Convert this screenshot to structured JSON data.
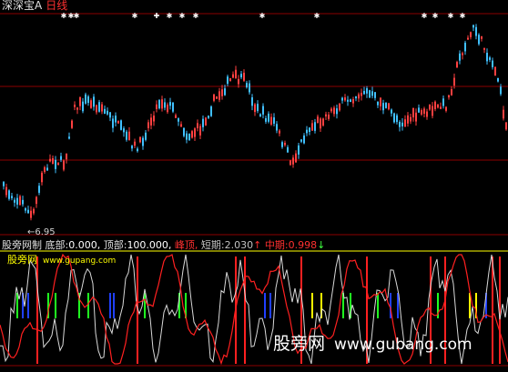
{
  "window": {
    "stock_name": "深深宝A",
    "timeframe": "日线"
  },
  "price_panel": {
    "low_label": "6.95"
  },
  "indicator_panel": {
    "name": "股旁网制",
    "bottom_label": "底部:",
    "bottom_value": "0.000,",
    "top_label": "顶部:",
    "top_value": "100.000,",
    "peak_label": "峰顶,",
    "short_label": "短期:",
    "short_value": "2.030",
    "mid_label": "中期:",
    "mid_value": "0.998",
    "up_arrow": "↑",
    "down_arrow": "↓"
  },
  "watermark": {
    "site_cn": "股旁网",
    "site_url": "www.gupang.com"
  },
  "brand": {
    "site_cn": "股旁网",
    "site_url": "www.gubang.com"
  },
  "colors": {
    "background": "#000000",
    "grid": "#8b0000",
    "candle_up": "#ff4040",
    "candle_down": "#40c0ff",
    "line_white": "#d8d8d8",
    "line_red": "#ff2020",
    "bar_green": "#20ff20",
    "bar_blue": "#2040ff",
    "bar_yellow": "#ffff00"
  }
}
